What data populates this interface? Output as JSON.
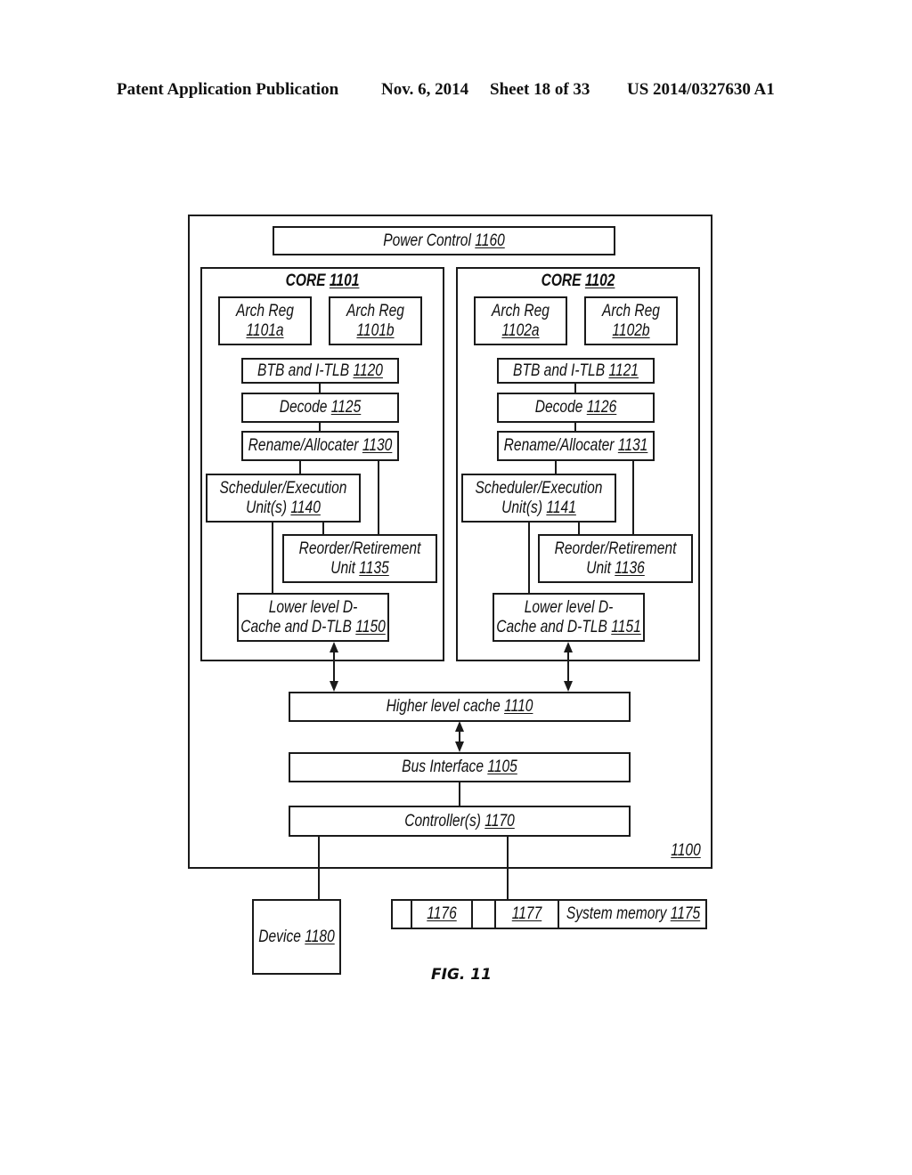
{
  "header": {
    "publication": "Patent Application Publication",
    "date": "Nov. 6, 2014",
    "sheet": "Sheet 18 of 33",
    "patent_number": "US 2014/0327630 A1"
  },
  "figure": {
    "caption": "FIG. 11",
    "system_ref": "1100",
    "power_control": {
      "label": "Power Control",
      "ref": "1160"
    },
    "cores": [
      {
        "title": "CORE",
        "ref": "1101",
        "arch_regs": [
          {
            "label": "Arch Reg",
            "ref": "1101a"
          },
          {
            "label": "Arch Reg",
            "ref": "1101b"
          }
        ],
        "btb": {
          "label": "BTB and I-TLB",
          "ref": "1120"
        },
        "decode": {
          "label": "Decode",
          "ref": "1125"
        },
        "rename": {
          "label": "Rename/Allocater",
          "ref": "1130"
        },
        "scheduler": {
          "line1": "Scheduler/Execution",
          "line2": "Unit(s)",
          "ref": "1140"
        },
        "reorder": {
          "line1": "Reorder/Retirement",
          "line2": "Unit",
          "ref": "1135"
        },
        "dcache": {
          "line1": "Lower level D-",
          "line2": "Cache and D-TLB",
          "ref": "1150"
        }
      },
      {
        "title": "CORE",
        "ref": "1102",
        "arch_regs": [
          {
            "label": "Arch Reg",
            "ref": "1102a"
          },
          {
            "label": "Arch Reg",
            "ref": "1102b"
          }
        ],
        "btb": {
          "label": "BTB and I-TLB",
          "ref": "1121"
        },
        "decode": {
          "label": "Decode",
          "ref": "1126"
        },
        "rename": {
          "label": "Rename/Allocater",
          "ref": "1131"
        },
        "scheduler": {
          "line1": "Scheduler/Execution",
          "line2": "Unit(s)",
          "ref": "1141"
        },
        "reorder": {
          "line1": "Reorder/Retirement",
          "line2": "Unit",
          "ref": "1136"
        },
        "dcache": {
          "line1": "Lower level D-",
          "line2": "Cache and D-TLB",
          "ref": "1151"
        }
      }
    ],
    "higher_cache": {
      "label": "Higher level cache",
      "ref": "1110"
    },
    "bus_interface": {
      "label": "Bus Interface",
      "ref": "1105"
    },
    "controllers": {
      "label": "Controller(s)",
      "ref": "1170"
    },
    "device": {
      "label": "Device",
      "ref": "1180"
    },
    "system_memory": {
      "label": "System memory",
      "ref": "1175",
      "segments": [
        "",
        "1176",
        "",
        "1177"
      ]
    }
  }
}
